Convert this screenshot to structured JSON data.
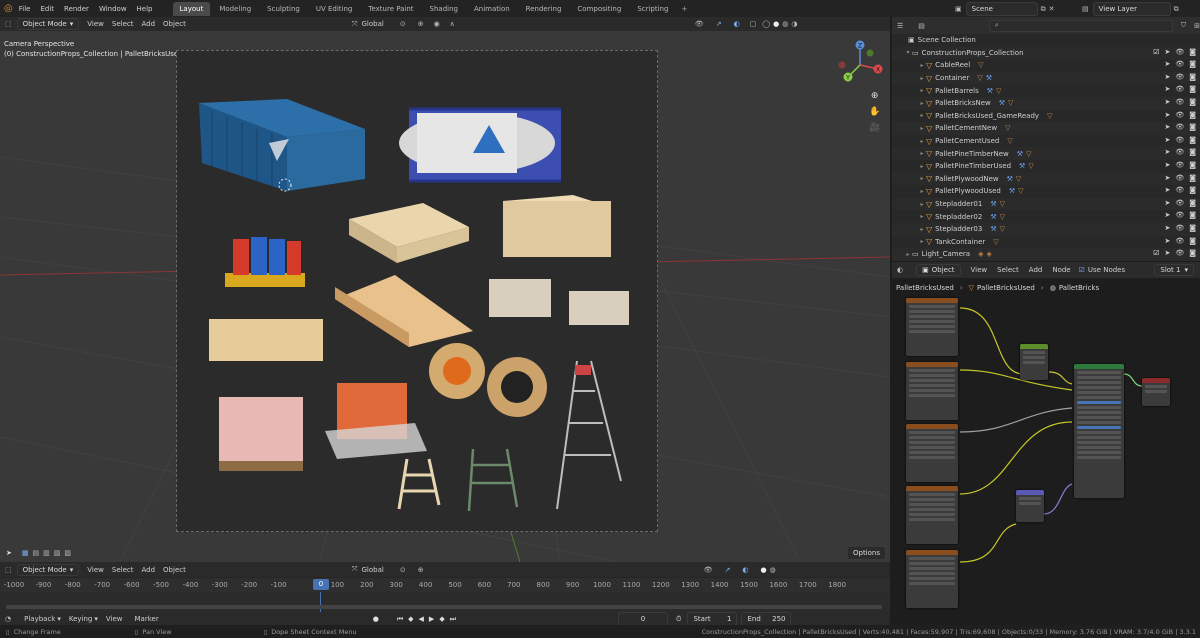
{
  "menubar": {
    "menus": [
      "File",
      "Edit",
      "Render",
      "Window",
      "Help"
    ],
    "workspaces": [
      "Layout",
      "Modeling",
      "Sculpting",
      "UV Editing",
      "Texture Paint",
      "Shading",
      "Animation",
      "Rendering",
      "Compositing",
      "Scripting"
    ],
    "active_workspace": "Layout",
    "scene_name": "Scene",
    "view_layer": "View Layer"
  },
  "viewport": {
    "mode": "Object Mode",
    "menus": [
      "View",
      "Select",
      "Add",
      "Object"
    ],
    "transform_orientation": "Global",
    "info_line1": "Camera Perspective",
    "info_line2": "(0) ConstructionProps_Collection | PalletBricksUsed",
    "gizmo": {
      "x": "X",
      "y": "Y",
      "z": "Z"
    }
  },
  "timeline": {
    "mode": "Object Mode",
    "menus": [
      "View",
      "Select",
      "Add",
      "Object"
    ],
    "transform_orientation": "Global",
    "options_label": "Options",
    "ruler_ticks": [
      "-1000",
      "-900",
      "-800",
      "-700",
      "-600",
      "-500",
      "-400",
      "-300",
      "-200",
      "-100",
      "0",
      "100",
      "200",
      "300",
      "400",
      "500",
      "600",
      "700",
      "800",
      "900",
      "1000",
      "1100",
      "1200",
      "1300",
      "1400",
      "1500",
      "1600",
      "1700",
      "1800"
    ],
    "current_frame_marker": "0",
    "playback_menus": [
      "Playback",
      "Keying",
      "View",
      "Marker"
    ],
    "current_frame": "0",
    "start_label": "Start",
    "start_value": "1",
    "end_label": "End",
    "end_value": "250"
  },
  "statusbar": {
    "left1": "Change Frame",
    "left2": "Pan View",
    "left3": "Dope Sheet Context Menu",
    "right": "ConstructionProps_Collection | PalletBricksUsed | Verts:40,481 | Faces:59,907 | Tris:69,608 | Objects:0/33 | Memory: 3.76 GiB | VRAM: 3.7/4.0 GiB | 3.3.1"
  },
  "outliner": {
    "search_placeholder": "",
    "root": "Scene Collection",
    "collection": "ConstructionProps_Collection",
    "items": [
      {
        "name": "CableReel",
        "extra": "mat"
      },
      {
        "name": "Container",
        "extra": "mat-mod-3"
      },
      {
        "name": "PalletBarrels",
        "extra": "mod-mat"
      },
      {
        "name": "PalletBricksNew",
        "extra": "mod-mat"
      },
      {
        "name": "PalletBricksUsed_GameReady",
        "extra": "mat",
        "selected": false
      },
      {
        "name": "PalletCementNew",
        "extra": "mat"
      },
      {
        "name": "PalletCementUsed",
        "extra": "mat"
      },
      {
        "name": "PalletPineTimberNew",
        "extra": "mod-mat"
      },
      {
        "name": "PalletPineTimberUsed",
        "extra": "mod-mat"
      },
      {
        "name": "PalletPlywoodNew",
        "extra": "mod-mat"
      },
      {
        "name": "PalletPlywoodUsed",
        "extra": "mod-mat"
      },
      {
        "name": "Stepladder01",
        "extra": "mod-mat"
      },
      {
        "name": "Stepladder02",
        "extra": "mod-mat"
      },
      {
        "name": "Stepladder03",
        "extra": "mod-mat"
      },
      {
        "name": "TankContainer",
        "extra": "mat"
      }
    ],
    "light_camera": "Light_Camera"
  },
  "nodeeditor": {
    "type": "Object",
    "menus": [
      "View",
      "Select",
      "Add",
      "Node"
    ],
    "use_nodes_label": "Use Nodes",
    "slot": "Slot 1",
    "breadcrumb": [
      "PalletBricksUsed",
      "PalletBricksUsed",
      "PalletBricks"
    ]
  },
  "colors": {
    "accent": "#4772b3",
    "selected_row": "#334d80",
    "mesh_icon": "#e8a04a",
    "wire_yellow": "#c7c729",
    "wire_grey": "#a0a0a0",
    "wire_purple": "#7f7fd6"
  }
}
